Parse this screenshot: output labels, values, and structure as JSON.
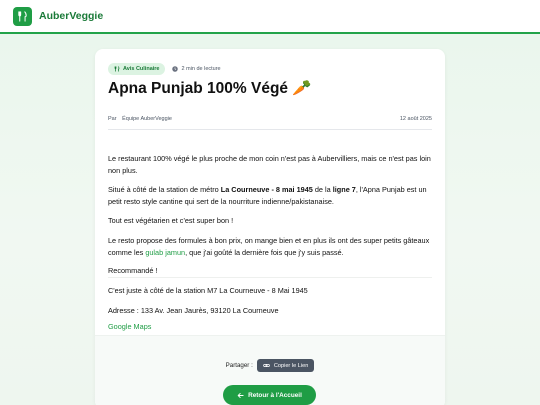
{
  "header": {
    "brand": "AuberVeggie"
  },
  "article": {
    "category": "Avis Culinaire",
    "read_time": "2 min de lecture",
    "title": "Apna Punjab 100% Végé 🥕",
    "by_label": "Par",
    "author": "Équipe AuberVeggie",
    "date": "12 août 2025",
    "p1": "Le restaurant 100% végé le plus proche de mon coin n'est pas à Aubervilliers, mais ce n'est pas loin non plus.",
    "p2_a": "Situé à côté de la station de métro ",
    "p2_b": "La Courneuve - 8 mai 1945",
    "p2_c": " de la ",
    "p2_d": "ligne 7",
    "p2_e": ", l'Apna Punjab est un petit resto style cantine qui sert de la nourriture indienne/pakistanaise.",
    "p3": "Tout est végétarien et c'est super bon !",
    "p4_a": "Le resto propose des formules à bon prix, on mange bien et en plus ils ont des super petits gâteaux comme les ",
    "p4_link": "gulab jamun",
    "p4_b": ", que j'ai goûté la dernière fois que j'y suis passé.",
    "p5": "Recommandé !",
    "p6": "C'est juste à côté de la station M7 La Courneuve - 8 Mai 1945",
    "p7": "Adresse : 133 Av. Jean Jaurès, 93120 La Courneuve",
    "maps_link": "Google Maps"
  },
  "footer": {
    "share_label": "Partager :",
    "copy_label": "Copier le Lien",
    "home_label": "Retour à l'Accueil"
  },
  "colors": {
    "accent": "#1f9d45",
    "badge_bg": "#dcf3e2",
    "copy_btn": "#4b5563"
  }
}
